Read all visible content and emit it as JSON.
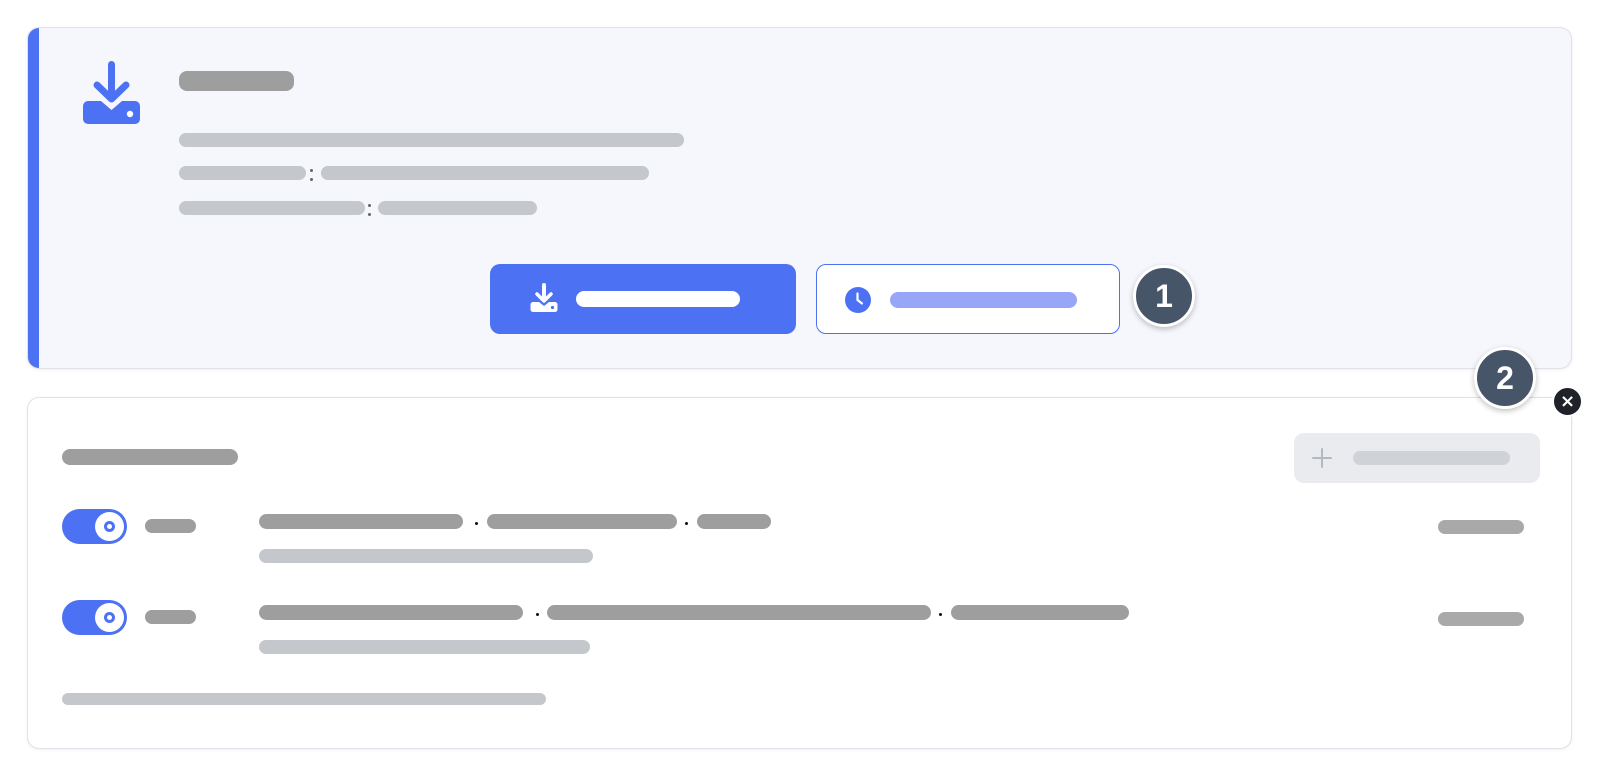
{
  "notice": {
    "title": "",
    "description": "",
    "detail_1_label": "",
    "detail_1_value": "",
    "detail_2_label": "",
    "detail_2_value": "",
    "primary_button_label": "",
    "secondary_button_label": "",
    "icon": "download-to-drive-icon",
    "accent_color": "#4d71f3"
  },
  "callouts": [
    "1",
    "2"
  ],
  "close_glyph": "×",
  "schedule": {
    "title": "",
    "add_button_label": "",
    "add_icon": "plus-icon",
    "rows": [
      {
        "enabled": true,
        "toggle_label": "",
        "time": "",
        "days": "",
        "target": "",
        "subtitle": "",
        "status": ""
      },
      {
        "enabled": true,
        "toggle_label": "",
        "time": "",
        "days": "",
        "target": "",
        "subtitle": "",
        "status": ""
      }
    ],
    "footer_note": ""
  }
}
